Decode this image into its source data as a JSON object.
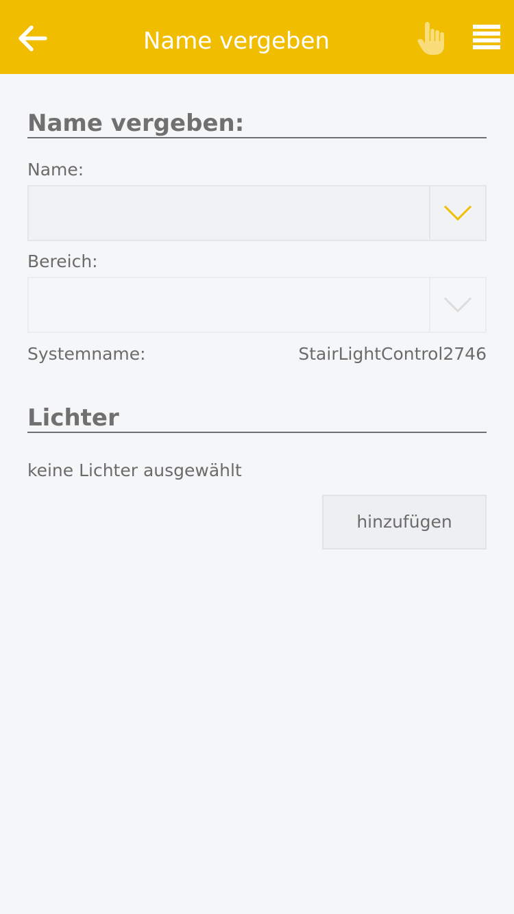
{
  "appbar": {
    "title": "Name vergeben",
    "back_icon": "arrow-left-icon",
    "touch_icon": "hand-pointer-icon",
    "menu_icon": "hamburger-menu-icon",
    "background": "#f0bd00",
    "touch_icon_color": "#f8dd7a"
  },
  "name_section": {
    "heading": "Name vergeben:",
    "name_field": {
      "label": "Name:",
      "value": "",
      "toggle_icon": "chevron-down-icon",
      "toggle_color": "#f0bd00"
    },
    "area_field": {
      "label": "Bereich:",
      "value": "",
      "toggle_icon": "chevron-down-icon",
      "toggle_color": "#dcdcdc",
      "disabled": true
    },
    "system_name": {
      "label": "Systemname:",
      "value": "StairLightControl2746"
    }
  },
  "lights_section": {
    "heading": "Lichter",
    "empty_text": "keine Lichter ausgewählt",
    "add_button_label": "hinzufügen"
  }
}
